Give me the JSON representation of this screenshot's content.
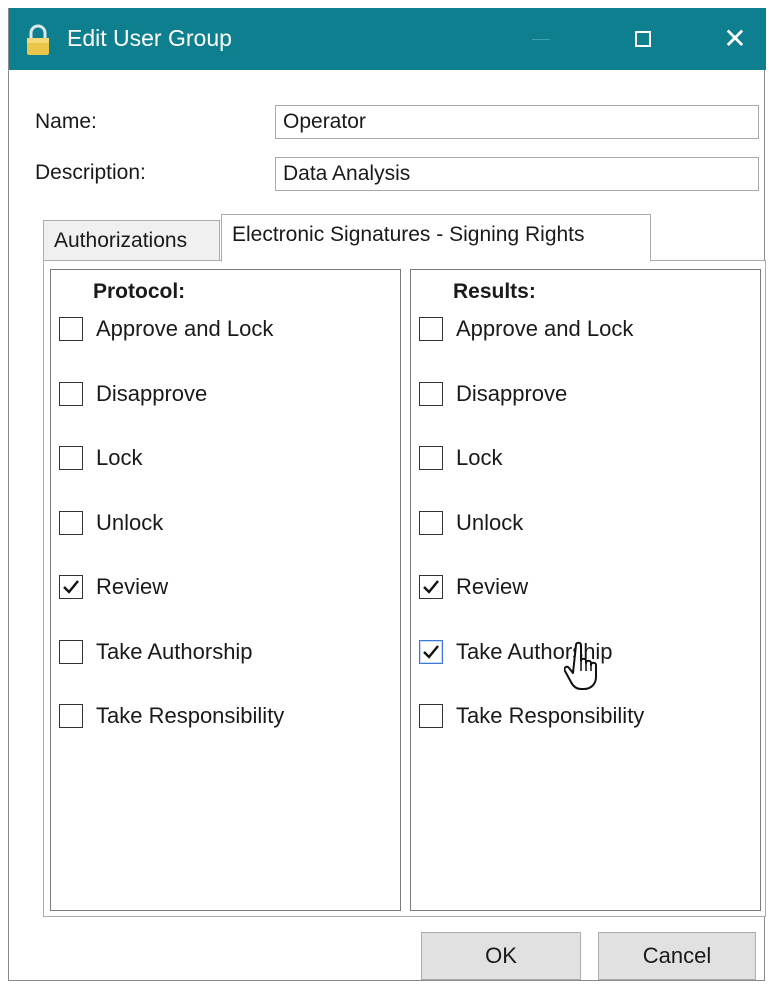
{
  "window": {
    "title": "Edit User Group",
    "title_icon": "lock-icon",
    "controls": [
      "minimize",
      "maximize",
      "close"
    ],
    "accent_color": "#0e7f8f"
  },
  "form": {
    "name_label": "Name:",
    "name_value": "Operator",
    "description_label": "Description:",
    "description_value": "Data Analysis"
  },
  "tabs": [
    {
      "label": "Authorizations",
      "active": false
    },
    {
      "label": "Electronic Signatures - Signing Rights",
      "active": true
    }
  ],
  "protocol": {
    "header": "Protocol:",
    "items": [
      {
        "label": "Approve and Lock",
        "checked": false
      },
      {
        "label": "Disapprove",
        "checked": false
      },
      {
        "label": "Lock",
        "checked": false
      },
      {
        "label": "Unlock",
        "checked": false
      },
      {
        "label": "Review",
        "checked": true
      },
      {
        "label": "Take Authorship",
        "checked": false
      },
      {
        "label": "Take Responsibility",
        "checked": false
      }
    ]
  },
  "results": {
    "header": "Results:",
    "items": [
      {
        "label": "Approve and Lock",
        "checked": false
      },
      {
        "label": "Disapprove",
        "checked": false
      },
      {
        "label": "Lock",
        "checked": false
      },
      {
        "label": "Unlock",
        "checked": false
      },
      {
        "label": "Review",
        "checked": true
      },
      {
        "label": "Take Authorship",
        "checked": true
      },
      {
        "label": "Take Responsibility",
        "checked": false
      }
    ]
  },
  "buttons": {
    "ok": "OK",
    "cancel": "Cancel"
  }
}
